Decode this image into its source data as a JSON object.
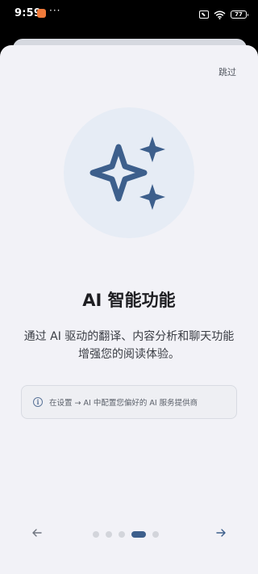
{
  "status_bar": {
    "time": "9:59",
    "more": "···",
    "battery": "77"
  },
  "sheet": {
    "skip_label": "跳过"
  },
  "hero": {
    "icon": "sparkles-icon",
    "circle_color": "#e6ecf5",
    "icon_color": "#3d5f8c"
  },
  "content": {
    "title": "AI 智能功能",
    "description": "通过 AI 驱动的翻译、内容分析和聊天功能增强您的阅读体验。",
    "tip_icon": "info-icon",
    "tip_text": "在设置 → AI 中配置您偏好的 AI 服务提供商"
  },
  "pager": {
    "page_count": 5,
    "current_page": 4
  },
  "navigation": {
    "back_icon": "arrow-left-icon",
    "next_icon": "arrow-right-icon"
  },
  "colors": {
    "accent": "#3d5f8c",
    "background": "#f2f2f7"
  }
}
